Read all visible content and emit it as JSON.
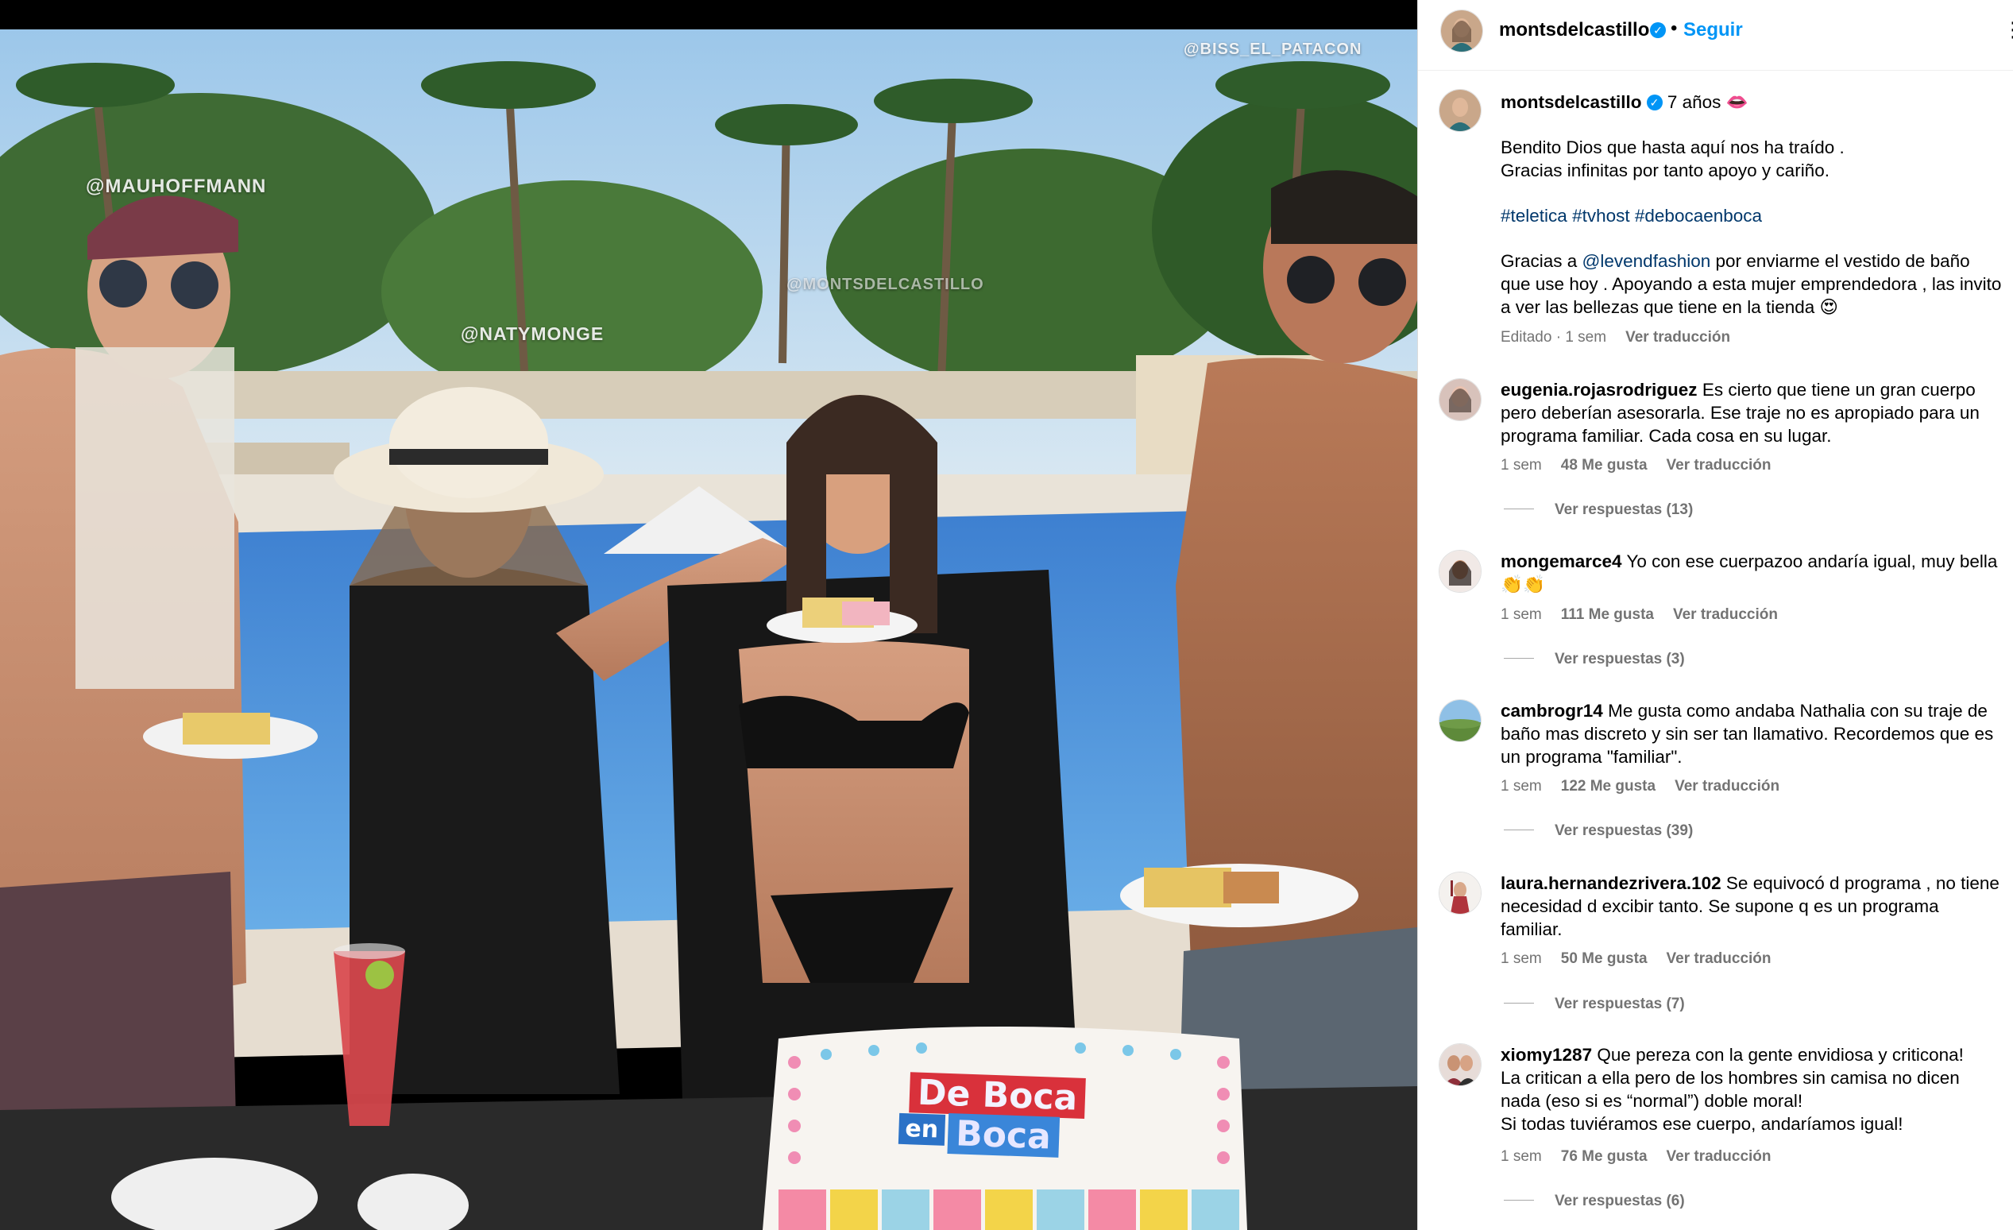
{
  "photo": {
    "watermarks": {
      "top_right": "@BISS_EL_PATACON",
      "left": "@MAUHOFFMANN",
      "center_left": "@NATYMONGE",
      "center": "@MONTSDELCASTILLO"
    },
    "cake_sign": {
      "word1": "De Boca",
      "word2": "en",
      "word3": "Boca"
    }
  },
  "header": {
    "username": "montsdelcastillo",
    "verified_icon": "✓",
    "separator": "•",
    "follow_label": "Seguir",
    "more_icon": "⋮"
  },
  "caption": {
    "username": "montsdelcastillo",
    "verified_icon": "✓",
    "headline": "7 años 👄",
    "line1": "Bendito Dios que hasta aquí nos ha traído .",
    "line2": "Gracias infinitas por tanto apoyo y cariño.",
    "hashtags": [
      "#teletica",
      "#tvhost",
      "#debocaenboca"
    ],
    "thanks_prefix": "Gracias a ",
    "mention": "@levendfashion",
    "thanks_suffix": " por enviarme el vestido de baño que use hoy . Apoyando a esta mujer emprendedora , las invito a ver las bellezas que tiene en la tienda 😍",
    "edited": "Editado · 1 sem",
    "translate": "Ver traducción"
  },
  "comments": [
    {
      "username": "eugenia.rojasrodriguez",
      "text": "Es cierto que tiene un gran cuerpo pero deberían asesorarla. Ese traje no es apropiado para un programa familiar. Cada cosa en su lugar.",
      "time": "1 sem",
      "likes": "48 Me gusta",
      "translate": "Ver traducción",
      "replies": "Ver respuestas (13)"
    },
    {
      "username": "mongemarce4",
      "text": "Yo con ese cuerpazoo andaría igual, muy bella 👏👏",
      "time": "1 sem",
      "likes": "111 Me gusta",
      "translate": "Ver traducción",
      "replies": "Ver respuestas (3)"
    },
    {
      "username": "cambrogr14",
      "text": "Me gusta como andaba Nathalia con su traje de baño mas discreto y sin ser tan llamativo. Recordemos que es un programa \"familiar\".",
      "time": "1 sem",
      "likes": "122 Me gusta",
      "translate": "Ver traducción",
      "replies": "Ver respuestas (39)"
    },
    {
      "username": "laura.hernandezrivera.102",
      "text": "Se equivocó d programa , no tiene necesidad d excibir tanto. Se supone q es un programa familiar.",
      "time": "1 sem",
      "likes": "50 Me gusta",
      "translate": "Ver traducción",
      "replies": "Ver respuestas (7)"
    },
    {
      "username": "xiomy1287",
      "line1": "Que pereza con la gente envidiosa y criticona!",
      "line2": "La critican a ella pero de los hombres sin camisa no dicen nada (eso si es “normal”) doble moral!",
      "line3": "Si todas tuviéramos ese cuerpo, andaríamos igual!",
      "time": "1 sem",
      "likes": "76 Me gusta",
      "translate": "Ver traducción",
      "replies": "Ver respuestas (6)"
    }
  ]
}
